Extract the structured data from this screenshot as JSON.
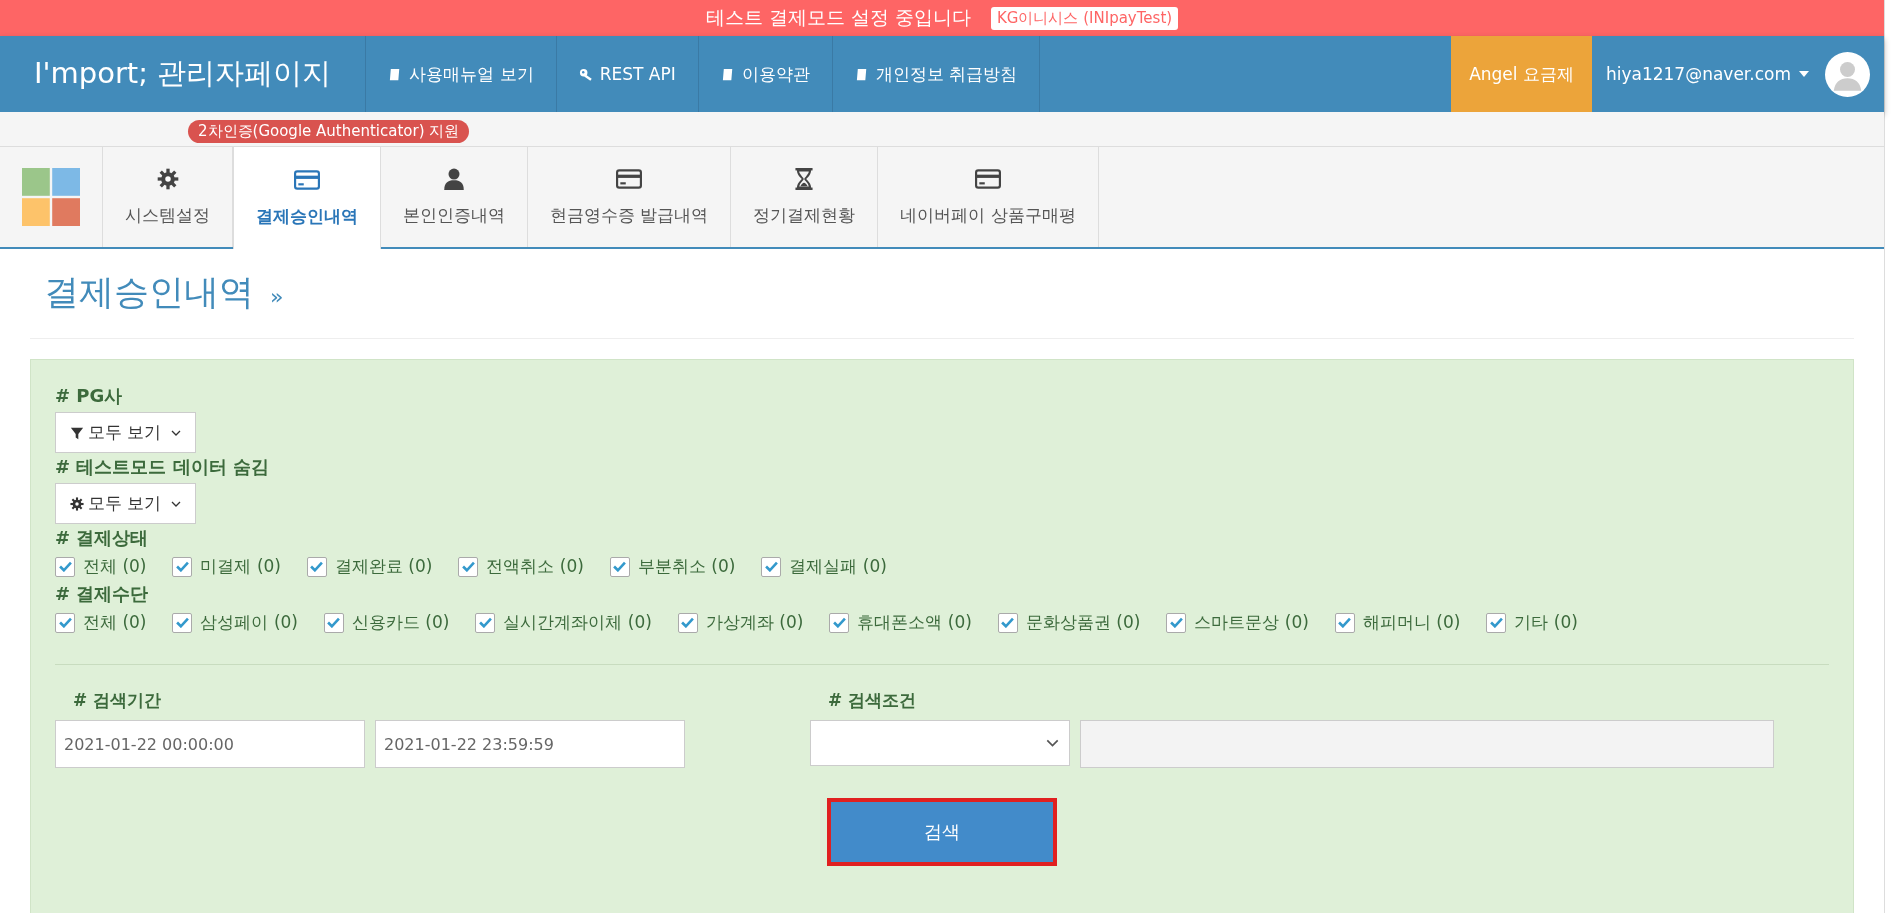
{
  "banner": {
    "text": "테스트 결제모드 설정 중입니다",
    "tag": "KG이니시스 (INIpayTest)"
  },
  "navbar": {
    "brand": "I'mport; 관리자페이지",
    "links": [
      {
        "label": "사용매뉴얼 보기",
        "kind": "book"
      },
      {
        "label": "REST API",
        "kind": "key"
      },
      {
        "label": "이용약관",
        "kind": "book"
      },
      {
        "label": "개인정보 취급방침",
        "kind": "book"
      }
    ],
    "plan": "Angel 요금제",
    "user": "hiya1217@naver.com"
  },
  "notice_badge": "2차인증(Google Authenticator) 지원",
  "tabs": [
    {
      "label": "시스템설정",
      "kind": "gear",
      "selected": false
    },
    {
      "label": "결제승인내역",
      "kind": "card",
      "selected": true
    },
    {
      "label": "본인인증내역",
      "kind": "person",
      "selected": false
    },
    {
      "label": "현금영수증 발급내역",
      "kind": "card",
      "selected": false
    },
    {
      "label": "정기결제현황",
      "kind": "hourglass",
      "selected": false
    },
    {
      "label": "네이버페이 상품구매평",
      "kind": "card",
      "selected": false
    }
  ],
  "page_title": "결제승인내역",
  "title_mark": "»",
  "filters": {
    "pg": {
      "label": "# PG사",
      "dropdown": "모두 보기",
      "kind": "filter"
    },
    "test_mode": {
      "label": "# 테스트모드 데이터 숨김",
      "dropdown": "모두 보기",
      "kind": "gear"
    },
    "status": {
      "label": "# 결제상태",
      "options": [
        {
          "label": "전체 (0)",
          "checked": true
        },
        {
          "label": "미결제 (0)",
          "checked": true
        },
        {
          "label": "결제완료 (0)",
          "checked": true
        },
        {
          "label": "전액취소 (0)",
          "checked": true
        },
        {
          "label": "부분취소 (0)",
          "checked": true
        },
        {
          "label": "결제실패 (0)",
          "checked": true
        }
      ]
    },
    "method": {
      "label": "# 결제수단",
      "options": [
        {
          "label": "전체 (0)",
          "checked": true
        },
        {
          "label": "삼성페이 (0)",
          "checked": true
        },
        {
          "label": "신용카드 (0)",
          "checked": true
        },
        {
          "label": "실시간계좌이체 (0)",
          "checked": true
        },
        {
          "label": "가상계좌 (0)",
          "checked": true
        },
        {
          "label": "휴대폰소액 (0)",
          "checked": true
        },
        {
          "label": "문화상품권 (0)",
          "checked": true
        },
        {
          "label": "스마트문상 (0)",
          "checked": true
        },
        {
          "label": "해피머니 (0)",
          "checked": true
        },
        {
          "label": "기타 (0)",
          "checked": true
        }
      ]
    },
    "period": {
      "label": "# 검색기간",
      "from": "2021-01-22 00:00:00",
      "to": "2021-01-22 23:59:59"
    },
    "condition": {
      "label": "# 검색조건"
    },
    "search_button": "검색"
  }
}
